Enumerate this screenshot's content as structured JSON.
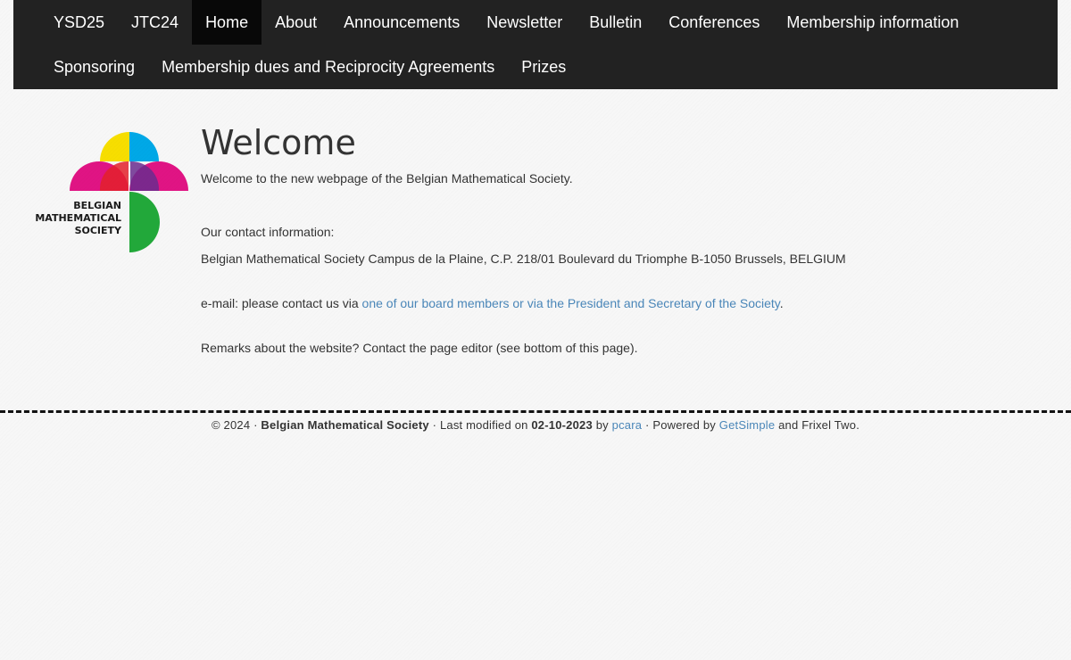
{
  "nav": {
    "row1": [
      {
        "label": "YSD25"
      },
      {
        "label": "JTC24"
      },
      {
        "label": "Home"
      },
      {
        "label": "About"
      },
      {
        "label": "Announcements"
      },
      {
        "label": "Newsletter"
      },
      {
        "label": "Bulletin"
      },
      {
        "label": "Conferences"
      },
      {
        "label": "Membership information"
      }
    ],
    "row2": [
      {
        "label": "Sponsoring"
      },
      {
        "label": "Membership dues and Reciprocity Agreements"
      },
      {
        "label": "Prizes"
      }
    ],
    "active": "Home"
  },
  "logo": {
    "line1": "BELGIAN",
    "line2": "MATHEMATICAL",
    "line3": "SOCIETY",
    "colors": {
      "yellow": "#ffe600",
      "cyan": "#00aeef",
      "magenta": "#e6007e",
      "green": "#22a83a"
    }
  },
  "main": {
    "title": "Welcome",
    "intro": "Welcome to the new webpage of the Belgian Mathematical Society.",
    "contact_heading": "Our contact information:",
    "address": "Belgian Mathematical Society Campus de la Plaine, C.P. 218/01 Boulevard du Triomphe B-1050 Brussels, BELGIUM",
    "email_prefix": "e-mail: please contact us via ",
    "email_link": "one of our board members or via the President and Secretary of the Society",
    "email_suffix": ".",
    "remarks": "Remarks about the website?  Contact the page editor (see bottom of this page)."
  },
  "footer": {
    "copyright": "© 2024 · ",
    "org": "Belgian Mathematical Society",
    "modified_prefix": " · Last modified on ",
    "modified_date": "02-10-2023",
    "by_prefix": " by ",
    "author": "pcara",
    "powered_prefix": " · Powered by ",
    "cms": "GetSimple",
    "powered_suffix": " and Frixel Two."
  },
  "colors": {
    "navbar_bg": "#222222",
    "nav_active_bg": "#080808",
    "link": "#4a86b8",
    "page_bg": "#f7f7f7"
  }
}
